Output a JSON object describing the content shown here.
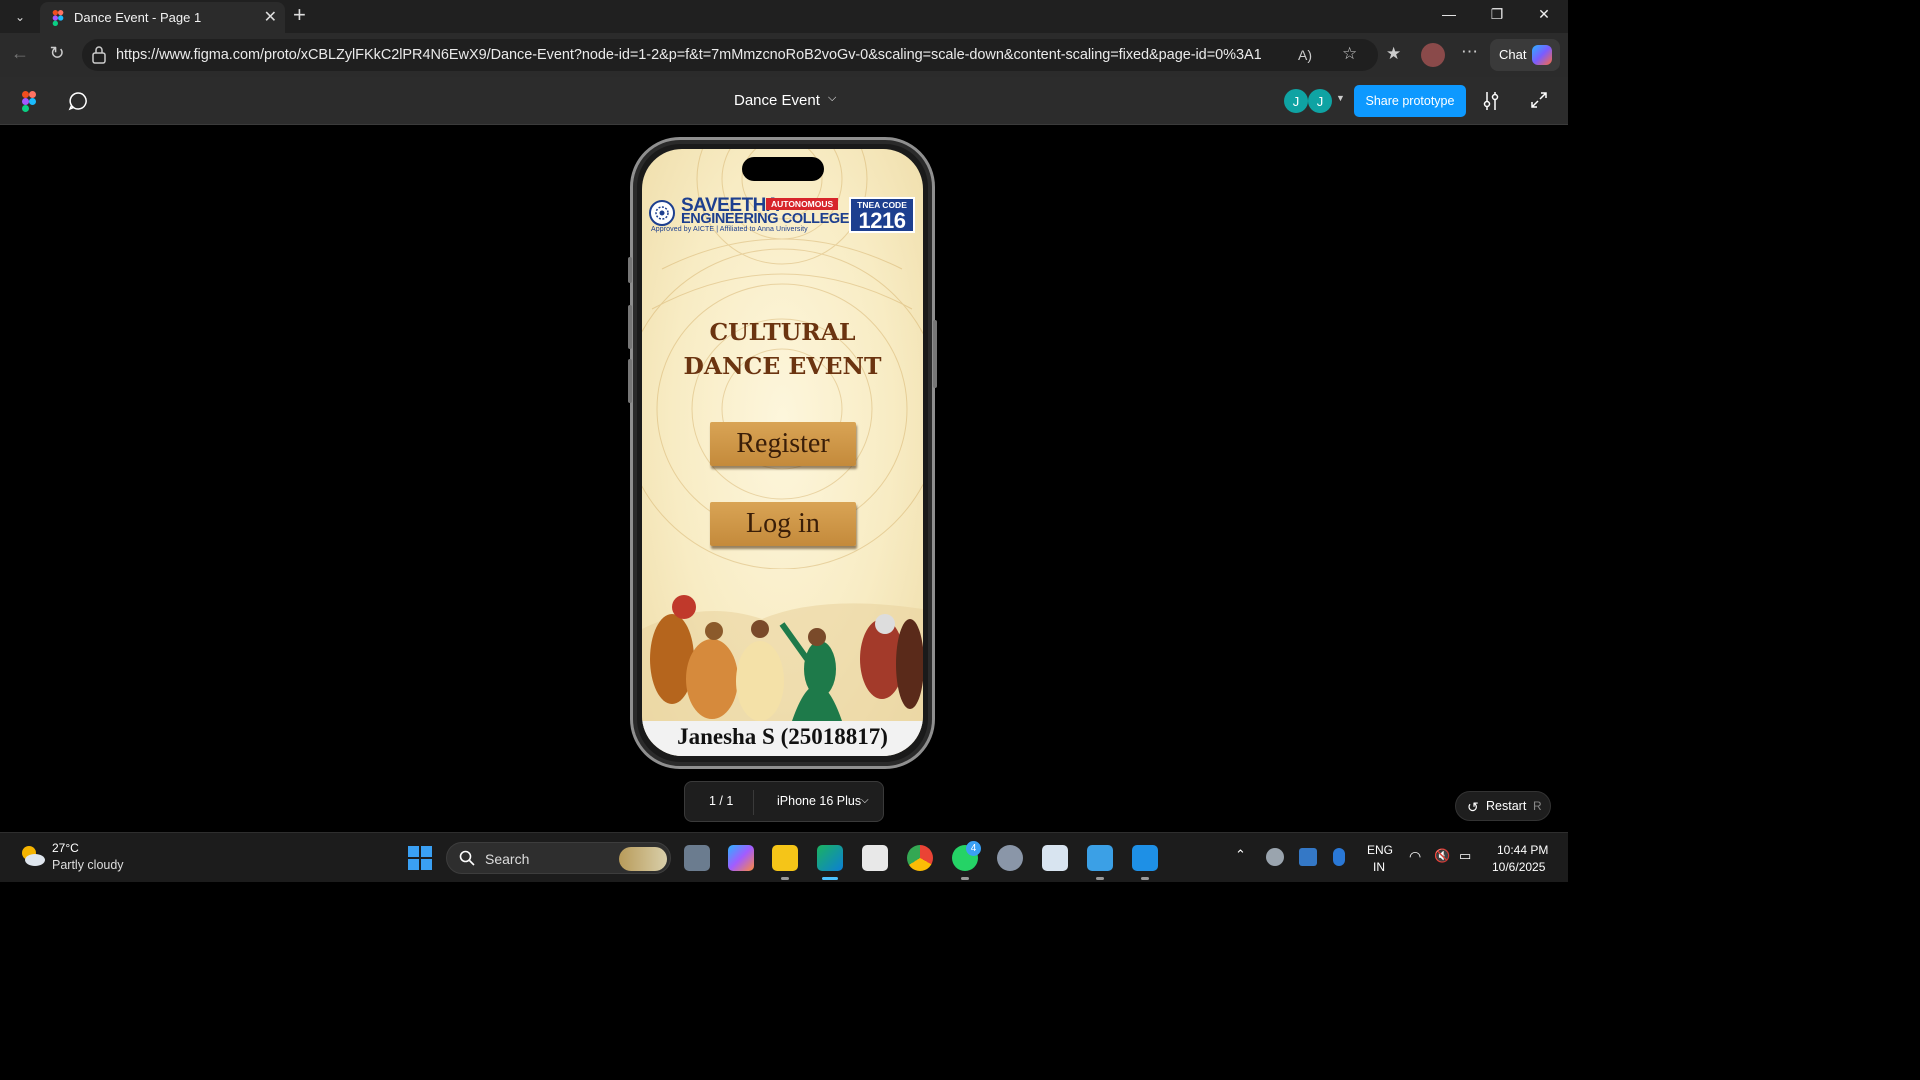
{
  "browser": {
    "tab_title": "Dance Event - Page 1",
    "url": "https://www.figma.com/proto/xCBLZylFKkC2lPR4N6EwX9/Dance-Event?node-id=1-2&p=f&t=7mMmzcnoRoB2voGv-0&scaling=scale-down&content-scaling=fixed&page-id=0%3A1",
    "chat_label": "Chat"
  },
  "figma": {
    "file_title": "Dance Event",
    "avatars": [
      "J",
      "J"
    ],
    "share_label": "Share prototype"
  },
  "screen": {
    "college_name_line1": "SAVEETHA",
    "college_name_line2": "ENGINEERING COLLEGE",
    "autonomous_badge": "AUTONOMOUS",
    "approved_text": "Approved by AICTE  |  Affiliated to Anna University",
    "tnea_label": "TNEA CODE",
    "tnea_code": "1216",
    "title_line1": "CULTURAL",
    "title_line2": "DANCE EVENT",
    "register_label": "Register",
    "login_label": "Log in",
    "author": "Janesha S (25018817)"
  },
  "prototype_controls": {
    "page_count": "1 / 1",
    "device": "iPhone 16 Plus",
    "restart_label": "Restart",
    "restart_key": "R"
  },
  "taskbar": {
    "temperature": "27°C",
    "weather": "Partly cloudy",
    "search_label": "Search",
    "whatsapp_badge": "4",
    "language_line1": "ENG",
    "language_line2": "IN",
    "time": "10:44 PM",
    "date": "10/6/2025"
  },
  "colors": {
    "figma_blue": "#0d99ff",
    "title_brown": "#6b3410",
    "button_gold": "#d9a455",
    "college_blue": "#1d3f8f"
  }
}
